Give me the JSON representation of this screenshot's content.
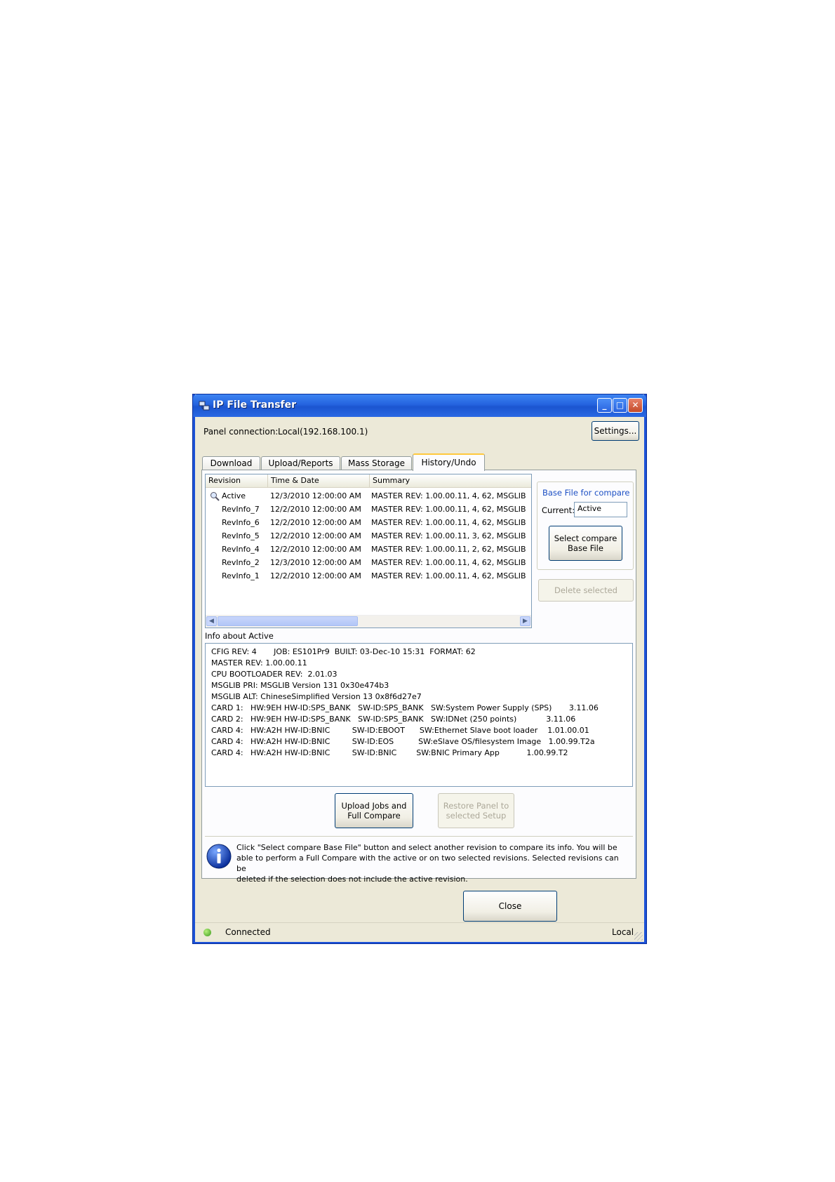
{
  "window": {
    "title": "IP File Transfer",
    "minimize": "_",
    "maximize": "□",
    "close": "✕"
  },
  "panel_connection": {
    "label": "Panel connection:",
    "value": "Local(192.168.100.1)"
  },
  "settings_button": "Settings...",
  "tabs": [
    {
      "label": "Download",
      "active": false
    },
    {
      "label": "Upload/Reports",
      "active": false
    },
    {
      "label": "Mass Storage",
      "active": false
    },
    {
      "label": "History/Undo",
      "active": true
    }
  ],
  "revisions": {
    "columns": [
      "Revision",
      "Time & Date",
      "Summary"
    ],
    "rows": [
      {
        "revision": "Active",
        "time": "12/3/2010 12:00:00 AM",
        "summary": "MASTER REV: 1.00.00.11, 4, 62, MSGLIB"
      },
      {
        "revision": "RevInfo_7",
        "time": "12/2/2010 12:00:00 AM",
        "summary": "MASTER REV: 1.00.00.11, 4, 62, MSGLIB"
      },
      {
        "revision": "RevInfo_6",
        "time": "12/2/2010 12:00:00 AM",
        "summary": "MASTER REV: 1.00.00.11, 4, 62, MSGLIB"
      },
      {
        "revision": "RevInfo_5",
        "time": "12/2/2010 12:00:00 AM",
        "summary": "MASTER REV: 1.00.00.11, 3, 62, MSGLIB"
      },
      {
        "revision": "RevInfo_4",
        "time": "12/2/2010 12:00:00 AM",
        "summary": "MASTER REV: 1.00.00.11, 2, 62, MSGLIB"
      },
      {
        "revision": "RevInfo_2",
        "time": "12/3/2010 12:00:00 AM",
        "summary": "MASTER REV: 1.00.00.11, 4, 62, MSGLIB"
      },
      {
        "revision": "RevInfo_1",
        "time": "12/2/2010 12:00:00 AM",
        "summary": "MASTER REV: 1.00.00.11, 4, 62, MSGLIB"
      }
    ]
  },
  "base_file": {
    "title": "Base File for compare",
    "current_label": "Current:",
    "current_value": "Active",
    "select_button": "Select compare\nBase File",
    "title_color": "#1c4fc4"
  },
  "delete_button": "Delete selected",
  "info": {
    "label": "Info about Active",
    "lines": [
      "CFIG REV: 4       JOB: ES101Pr9  BUILT: 03-Dec-10 15:31  FORMAT: 62",
      "MASTER REV: 1.00.00.11",
      "CPU BOOTLOADER REV:  2.01.03",
      "MSGLIB PRI: MSGLIB Version 131 0x30e474b3",
      "MSGLIB ALT: ChineseSimplified Version 13 0x8f6d27e7",
      "CARD 1:   HW:9EH HW-ID:SPS_BANK   SW-ID:SPS_BANK   SW:System Power Supply (SPS)       3.11.06",
      "CARD 2:   HW:9EH HW-ID:SPS_BANK   SW-ID:SPS_BANK   SW:IDNet (250 points)            3.11.06",
      "CARD 4:   HW:A2H HW-ID:BNIC         SW-ID:EBOOT      SW:Ethernet Slave boot loader    1.01.00.01",
      "CARD 4:   HW:A2H HW-ID:BNIC         SW-ID:EOS          SW:eSlave OS/filesystem Image   1.00.99.T2a",
      "CARD 4:   HW:A2H HW-ID:BNIC         SW-ID:BNIC        SW:BNIC Primary App           1.00.99.T2"
    ]
  },
  "upload_button": "Upload Jobs and\nFull Compare",
  "restore_button": "Restore Panel to\nselected Setup",
  "hint": "Click \"Select compare Base File\" button and select another revision to compare its info. You will be\nable to perform a Full Compare with the active or on two selected revisions. Selected revisions can be\ndeleted if the selection does not include the active revision.",
  "close_button": "Close",
  "status": {
    "left": "Connected",
    "right": "Local"
  }
}
